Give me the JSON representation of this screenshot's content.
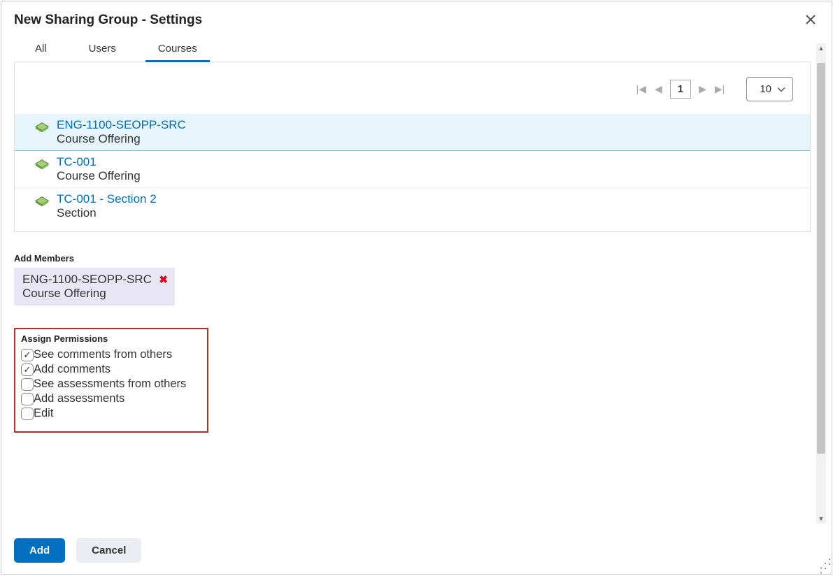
{
  "dialog": {
    "title": "New Sharing Group - Settings"
  },
  "tabs": [
    {
      "label": "All",
      "active": false
    },
    {
      "label": "Users",
      "active": false
    },
    {
      "label": "Courses",
      "active": true
    }
  ],
  "pager": {
    "current_page": "1",
    "page_size": "10"
  },
  "courses": [
    {
      "name": "ENG-1100-SEOPP-SRC",
      "type": "Course Offering",
      "selected": true
    },
    {
      "name": "TC-001",
      "type": "Course Offering",
      "selected": false
    },
    {
      "name": "TC-001 - Section 2",
      "type": "Section",
      "selected": false
    }
  ],
  "add_members": {
    "label": "Add Members",
    "items": [
      {
        "name": "ENG-1100-SEOPP-SRC",
        "type": "Course Offering"
      }
    ]
  },
  "permissions": {
    "title": "Assign Permissions",
    "items": [
      {
        "label": "See comments from others",
        "checked": true
      },
      {
        "label": "Add comments",
        "checked": true
      },
      {
        "label": "See assessments from others",
        "checked": false
      },
      {
        "label": "Add assessments",
        "checked": false
      },
      {
        "label": "Edit",
        "checked": false
      }
    ]
  },
  "buttons": {
    "add": "Add",
    "cancel": "Cancel"
  }
}
